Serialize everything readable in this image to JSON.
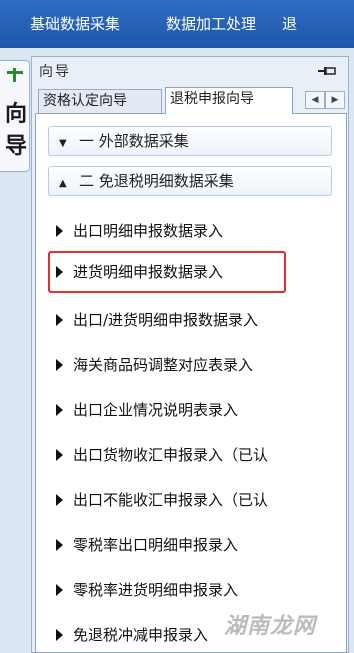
{
  "menubar": {
    "items": [
      "基础数据采集",
      "数据加工处理",
      "退"
    ]
  },
  "sidetab": {
    "label": "向导"
  },
  "panel": {
    "title": "向导",
    "tabs": [
      {
        "label": "资格认定向导",
        "active": false
      },
      {
        "label": "退税申报向导",
        "active": true
      }
    ]
  },
  "groups": [
    {
      "label": "一 外部数据采集",
      "expanded": false
    },
    {
      "label": "二 免退税明细数据采集",
      "expanded": true
    }
  ],
  "items": [
    {
      "label": "出口明细申报数据录入"
    },
    {
      "label": "进货明细申报数据录入",
      "highlighted": true
    },
    {
      "label": "出口/进货明细申报数据录入"
    },
    {
      "label": "海关商品码调整对应表录入"
    },
    {
      "label": "出口企业情况说明表录入"
    },
    {
      "label": "出口货物收汇申报录入（已认"
    },
    {
      "label": "出口不能收汇申报录入（已认"
    },
    {
      "label": "零税率出口明细申报录入"
    },
    {
      "label": "零税率进货明细申报录入"
    },
    {
      "label": "免退税冲减申报录入"
    }
  ],
  "watermark": "湖南龙网",
  "colors": {
    "menubar": "#2462b8",
    "highlight": "#e12e2e"
  }
}
